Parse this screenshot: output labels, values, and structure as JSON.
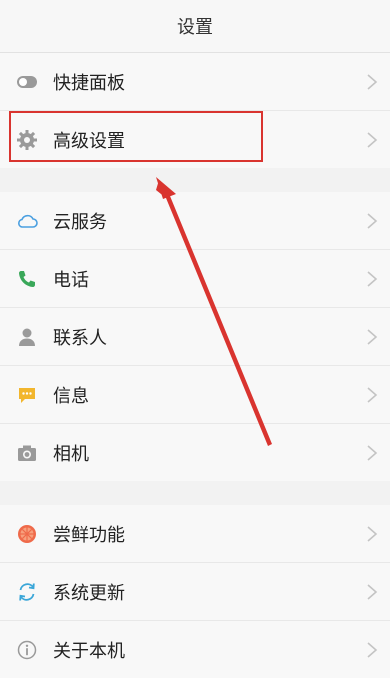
{
  "header": {
    "title": "设置"
  },
  "group1": [
    {
      "label": "快捷面板",
      "icon": "toggle-icon"
    },
    {
      "label": "高级设置",
      "icon": "gear-icon"
    }
  ],
  "group2": [
    {
      "label": "云服务",
      "icon": "cloud-icon"
    },
    {
      "label": "电话",
      "icon": "phone-icon"
    },
    {
      "label": "联系人",
      "icon": "person-icon"
    },
    {
      "label": "信息",
      "icon": "message-icon"
    },
    {
      "label": "相机",
      "icon": "camera-icon"
    }
  ],
  "group3": [
    {
      "label": "尝鲜功能",
      "icon": "citrus-icon"
    },
    {
      "label": "系统更新",
      "icon": "refresh-icon"
    },
    {
      "label": "关于本机",
      "icon": "info-icon"
    }
  ],
  "colors": {
    "highlight": "#d9342f",
    "cloud": "#4a9fe0",
    "phone": "#3aa85a",
    "message": "#f2b62d",
    "citrus": "#ef6a4a",
    "refresh": "#3aa6d8",
    "muted": "#9a9a9a"
  }
}
